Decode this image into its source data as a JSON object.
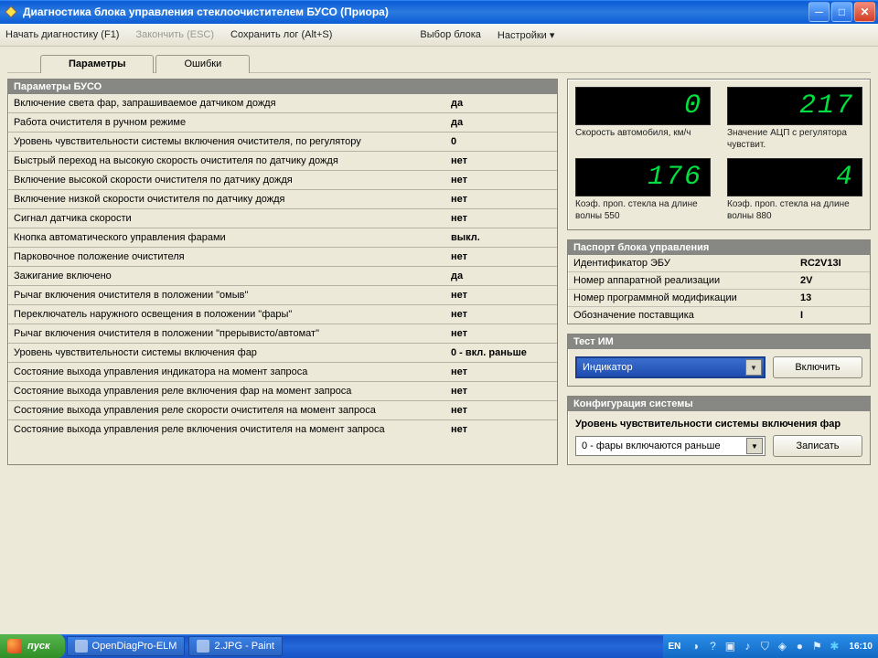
{
  "window": {
    "title": "Диагностика блока управления стеклоочистителем БУСО (Приора)"
  },
  "toolbar": {
    "start": "Начать диагностику (F1)",
    "stop": "Закончить (ESC)",
    "saveLog": "Сохранить лог (Alt+S)",
    "selectBlock": "Выбор блока",
    "settings": "Настройки ▾"
  },
  "tabs": {
    "params": "Параметры",
    "errors": "Ошибки"
  },
  "paramsSection": "Параметры БУСО",
  "params": [
    {
      "label": "Включение света фар, запрашиваемое датчиком дождя",
      "value": "да"
    },
    {
      "label": "Работа очистителя в ручном режиме",
      "value": "да"
    },
    {
      "label": "Уровень чувствительности системы включения очистителя, по регулятору",
      "value": "0"
    },
    {
      "label": "Быстрый переход на высокую скорость очистителя по датчику дождя",
      "value": "нет"
    },
    {
      "label": "Включение высокой скорости очистителя по датчику дождя",
      "value": "нет"
    },
    {
      "label": "Включение низкой скорости очистителя по датчику дождя",
      "value": "нет"
    },
    {
      "label": "Сигнал датчика скорости",
      "value": "нет"
    },
    {
      "label": "Кнопка автоматического управления фарами",
      "value": "выкл."
    },
    {
      "label": "Парковочное положение очистителя",
      "value": "нет"
    },
    {
      "label": "Зажигание включено",
      "value": "да"
    },
    {
      "label": "Рычаг включения очистителя в положении \"омыв\"",
      "value": "нет"
    },
    {
      "label": "Переключатель наружного освещения в положении \"фары\"",
      "value": "нет"
    },
    {
      "label": "Рычаг включения очистителя в положении \"прерывисто/автомат\"",
      "value": "нет"
    },
    {
      "label": "Уровень чувствительности системы включения фар",
      "value": "0 - вкл. раньше"
    },
    {
      "label": "Состояние выхода управления индикатора на момент запроса",
      "value": "нет"
    },
    {
      "label": "Состояние выхода управления реле включения фар на момент запроса",
      "value": "нет"
    },
    {
      "label": "Состояние выхода управления реле скорости очистителя на момент запроса",
      "value": "нет"
    },
    {
      "label": "Состояние выхода управления реле включения очистителя на момент запроса",
      "value": "нет"
    }
  ],
  "gauges": [
    {
      "value": "0",
      "label": "Скорость автомобиля, км/ч"
    },
    {
      "value": "217",
      "label": "Значение АЦП с регулятора чувствит."
    },
    {
      "value": "176",
      "label": "Коэф. проп. стекла на длине волны 550"
    },
    {
      "value": "4",
      "label": "Коэф. проп. стекла на длине волны 880"
    }
  ],
  "passport": {
    "header": "Паспорт блока управления",
    "rows": [
      {
        "k": "Идентификатор ЭБУ",
        "v": "RC2V13I"
      },
      {
        "k": "Номер аппаратной реализации",
        "v": "2V"
      },
      {
        "k": "Номер программной модификации",
        "v": "13"
      },
      {
        "k": "Обозначение поставщика",
        "v": "I"
      }
    ]
  },
  "testIM": {
    "header": "Тест ИМ",
    "selected": "Индикатор",
    "button": "Включить"
  },
  "config": {
    "header": "Конфигурация системы",
    "note": "Уровень чувствительности системы включения фар",
    "selected": "0 - фары включаются раньше",
    "button": "Записать"
  },
  "taskbar": {
    "start": "пуск",
    "items": [
      "OpenDiagPro-ELM",
      "2.JPG - Paint"
    ],
    "lang": "EN",
    "clock": "16:10"
  }
}
